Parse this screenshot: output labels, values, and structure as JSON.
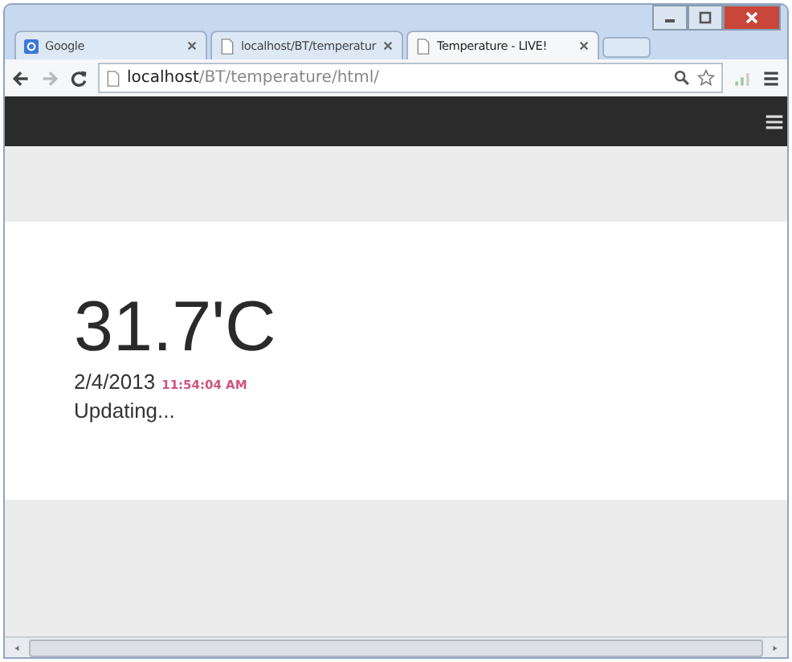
{
  "tabs": [
    {
      "title": "Google",
      "kind": "google",
      "selected": false
    },
    {
      "title": "localhost/BT/temperatur",
      "kind": "page",
      "selected": false
    },
    {
      "title": "Temperature - LIVE!",
      "kind": "page",
      "selected": true
    }
  ],
  "address": {
    "host": "localhost",
    "path": "/BT/temperature/html/"
  },
  "reading": {
    "temperature": "31.7'C",
    "date": "2/4/2013",
    "time": "11:54:04 AM",
    "status": "Updating..."
  }
}
